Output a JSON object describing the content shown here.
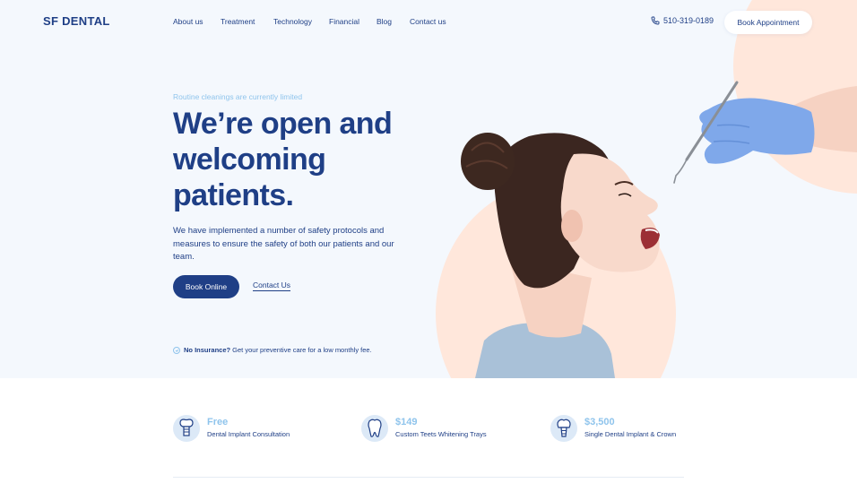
{
  "brand": {
    "logo": "SF DENTAL"
  },
  "nav": {
    "items": [
      "About us",
      "Treatment",
      "Technology",
      "Financial",
      "Blog",
      "Contact us"
    ],
    "phone": "510-319-0189",
    "book_appointment": "Book Appointment"
  },
  "hero": {
    "eyebrow": "Routine cleanings are currently limited",
    "headline": "We’re open and welcoming patients.",
    "subtext": "We have implemented a number of safety protocols and measures to ensure the safety of both our patients and our team.",
    "primary_button": "Book Online",
    "secondary_link": "Contact Us",
    "insurance_bold": "No Insurance?",
    "insurance_text": " Get your preventive care for a low monthly fee."
  },
  "services": [
    {
      "price": "Free",
      "label": "Dental Implant Consultation",
      "icon": "dental-implant-icon"
    },
    {
      "price": "$149",
      "label": "Custom Teets Whitening Trays",
      "icon": "tooth-icon"
    },
    {
      "price": "$3,500",
      "label": "Single Dental Implant & Crown",
      "icon": "implant-crown-icon"
    }
  ],
  "colors": {
    "brand_navy": "#1f3f86",
    "accent_light_blue": "#8fc4ec",
    "peach": "#ffe7db",
    "hero_background": "#f4f8fd",
    "glove_blue": "#7fa8ea"
  }
}
